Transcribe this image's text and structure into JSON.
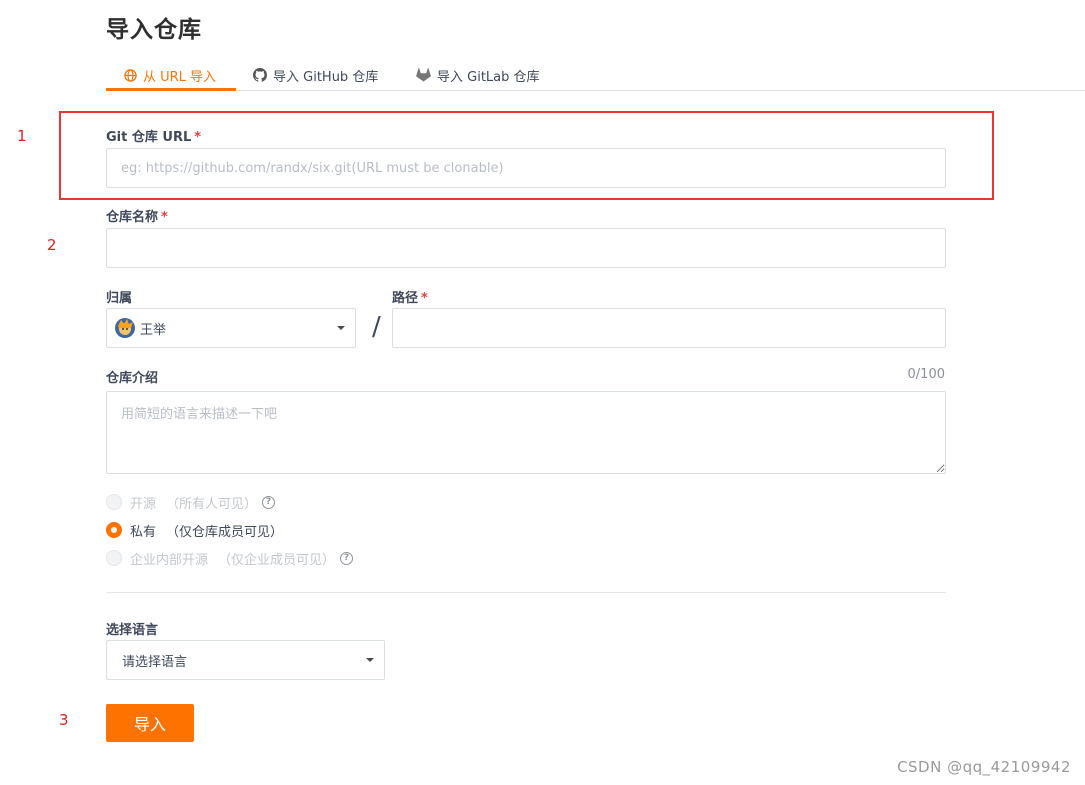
{
  "page": {
    "title": "导入仓库"
  },
  "tabs": [
    {
      "label": "从 URL 导入",
      "icon": "globe-icon",
      "active": true
    },
    {
      "label": "导入 GitHub 仓库",
      "icon": "github-icon",
      "active": false
    },
    {
      "label": "导入 GitLab 仓库",
      "icon": "gitlab-icon",
      "active": false
    }
  ],
  "annotations": {
    "step1": "1",
    "step2": "2",
    "step3": "3"
  },
  "form": {
    "git_url": {
      "label": "Git 仓库 URL",
      "required_mark": "*",
      "placeholder": "eg: https://github.com/randx/six.git(URL must be clonable)",
      "value": ""
    },
    "repo_name": {
      "label": "仓库名称",
      "required_mark": "*",
      "value": ""
    },
    "owner": {
      "label": "归属",
      "value": "王举",
      "avatar_icon": "user-avatar"
    },
    "separator": "/",
    "path": {
      "label": "路径",
      "required_mark": "*",
      "value": ""
    },
    "description": {
      "label": "仓库介绍",
      "counter": "0/100",
      "placeholder": "用简短的语言来描述一下吧",
      "value": ""
    },
    "visibility": {
      "options": [
        {
          "label": "开源",
          "hint": "（所有人可见）",
          "disabled": true,
          "checked": false,
          "help_icon": "question-circle-icon"
        },
        {
          "label": "私有",
          "hint": "（仅仓库成员可见）",
          "disabled": false,
          "checked": true
        },
        {
          "label": "企业内部开源",
          "hint": "（仅企业成员可见）",
          "disabled": true,
          "checked": false,
          "help_icon": "question-circle-icon"
        }
      ]
    },
    "language": {
      "label": "选择语言",
      "value": "请选择语言"
    },
    "submit_label": "导入"
  },
  "watermark": "CSDN @qq_42109942",
  "colors": {
    "accent": "#fe7300",
    "highlight": "#ea3433",
    "annotation": "#e02020"
  }
}
